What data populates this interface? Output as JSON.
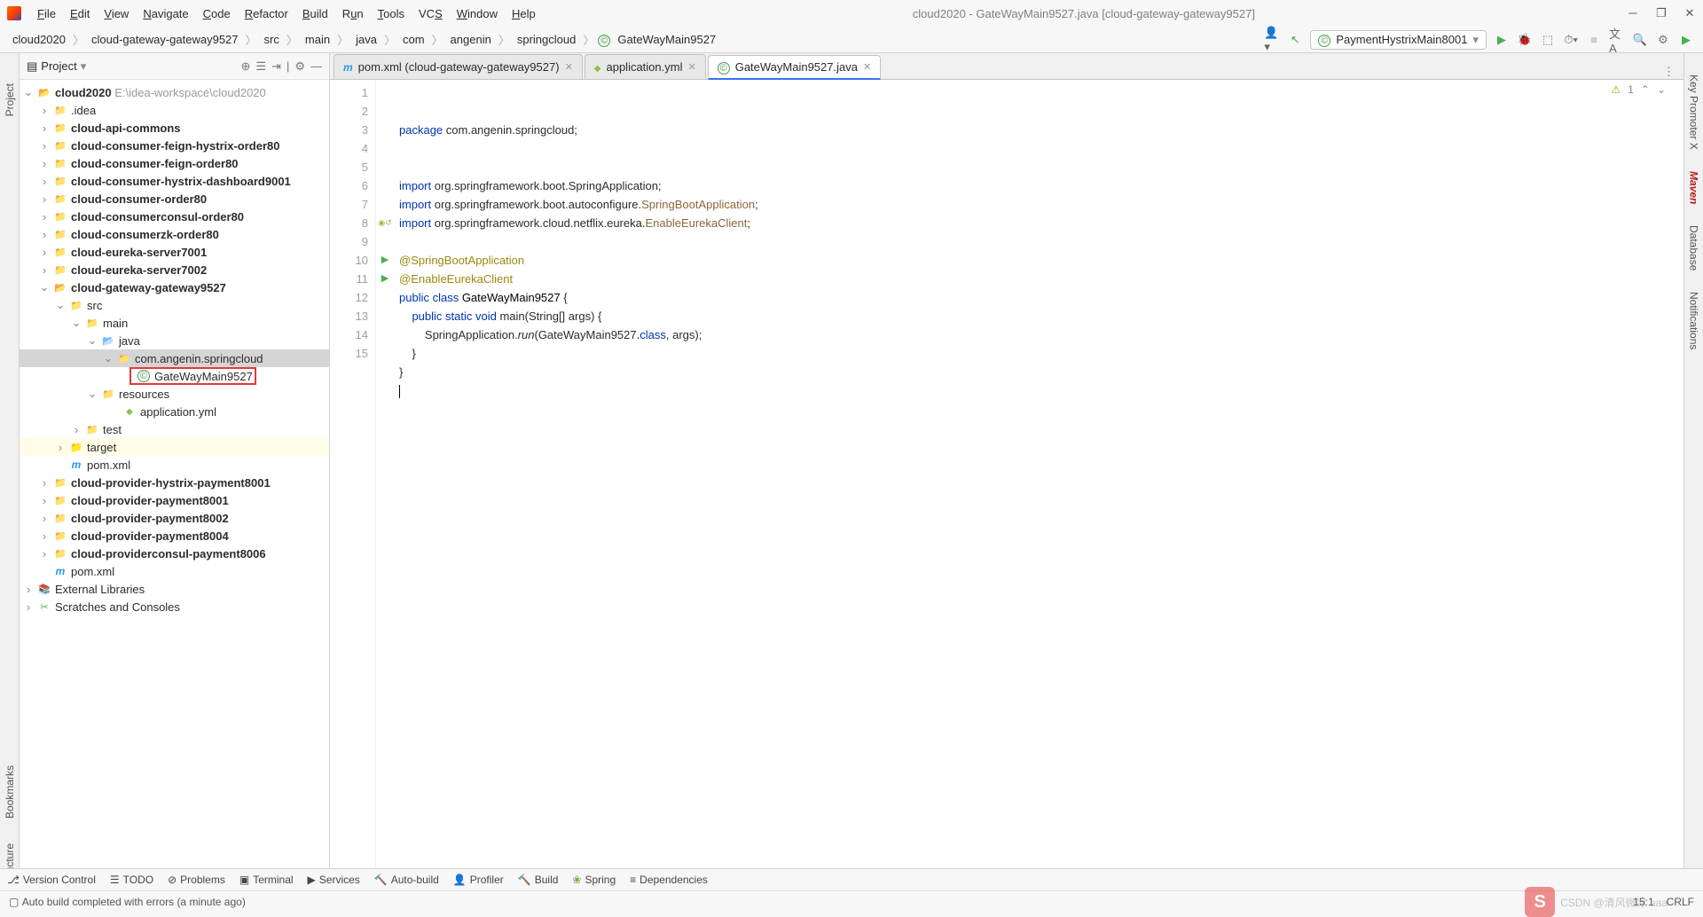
{
  "window": {
    "title": "cloud2020 - GateWayMain9527.java [cloud-gateway-gateway9527]"
  },
  "menu": [
    "File",
    "Edit",
    "View",
    "Navigate",
    "Code",
    "Refactor",
    "Build",
    "Run",
    "Tools",
    "VCS",
    "Window",
    "Help"
  ],
  "breadcrumb": [
    "cloud2020",
    "cloud-gateway-gateway9527",
    "src",
    "main",
    "java",
    "com",
    "angenin",
    "springcloud",
    "GateWayMain9527"
  ],
  "runconfig": "PaymentHystrixMain8001",
  "sidebar": {
    "title": "Project",
    "root": {
      "name": "cloud2020",
      "path": "E:\\idea-workspace\\cloud2020"
    },
    "items": [
      {
        "name": ".idea",
        "bold": false
      },
      {
        "name": "cloud-api-commons",
        "bold": true
      },
      {
        "name": "cloud-consumer-feign-hystrix-order80",
        "bold": true
      },
      {
        "name": "cloud-consumer-feign-order80",
        "bold": true
      },
      {
        "name": "cloud-consumer-hystrix-dashboard9001",
        "bold": true
      },
      {
        "name": "cloud-consumer-order80",
        "bold": true
      },
      {
        "name": "cloud-consumerconsul-order80",
        "bold": true
      },
      {
        "name": "cloud-consumerzk-order80",
        "bold": true
      },
      {
        "name": "cloud-eureka-server7001",
        "bold": true
      },
      {
        "name": "cloud-eureka-server7002",
        "bold": true
      }
    ],
    "gateway": {
      "name": "cloud-gateway-gateway9527",
      "src": "src",
      "main": "main",
      "java": "java",
      "pkg": "com.angenin.springcloud",
      "file": "GateWayMain9527",
      "resources": "resources",
      "yml": "application.yml",
      "test": "test",
      "target": "target",
      "pom": "pom.xml"
    },
    "items2": [
      {
        "name": "cloud-provider-hystrix-payment8001"
      },
      {
        "name": "cloud-provider-payment8001"
      },
      {
        "name": "cloud-provider-payment8002"
      },
      {
        "name": "cloud-provider-payment8004"
      },
      {
        "name": "cloud-providerconsul-payment8006"
      }
    ],
    "pom": "pom.xml",
    "ext": "External Libraries",
    "scratch": "Scratches and Consoles"
  },
  "leftrail": [
    "Project",
    "Bookmarks",
    "Structure"
  ],
  "rightrail": [
    "Key Promoter X",
    "Maven",
    "Database",
    "Notifications"
  ],
  "tabs": [
    {
      "label": "pom.xml (cloud-gateway-gateway9527)",
      "icon": "m"
    },
    {
      "label": "application.yml",
      "icon": "yml"
    },
    {
      "label": "GateWayMain9527.java",
      "icon": "java",
      "active": true
    }
  ],
  "code": {
    "lines": [
      "1",
      "2",
      "3",
      "4",
      "5",
      "6",
      "7",
      "8",
      "9",
      "10",
      "11",
      "12",
      "13",
      "14",
      "15"
    ],
    "l1_kw": "package",
    "l1_rest": " com.angenin.springcloud;",
    "l4_kw": "import",
    "l4_rest": " org.springframework.boot.SpringApplication;",
    "l5_kw": "import",
    "l5_rest1": " org.springframework.boot.autoconfigure.",
    "l5_cls": "SpringBootApplication",
    "l5_rest2": ";",
    "l6_kw": "import",
    "l6_rest1": " org.springframework.cloud.netflix.eureka.",
    "l6_cls": "EnableEurekaClient",
    "l6_rest2": ";",
    "l8": "@SpringBootApplication",
    "l9": "@EnableEurekaClient",
    "l10_kw1": "public ",
    "l10_kw2": "class ",
    "l10_cls": "GateWayMain9527",
    "l10_rest": " {",
    "l11_kw1": "    public ",
    "l11_kw2": "static ",
    "l11_kw3": "void ",
    "l11_fn": "main",
    "l11_rest": "(String[] args) {",
    "l12_pre": "        SpringApplication.",
    "l12_fn": "run",
    "l12_rest1": "(GateWayMain9527.",
    "l12_kw": "class",
    "l12_rest2": ", args);",
    "l13": "    }",
    "l14": "}"
  },
  "warnings": {
    "count": "1"
  },
  "bottombar": [
    "Version Control",
    "TODO",
    "Problems",
    "Terminal",
    "Services",
    "Auto-build",
    "Profiler",
    "Build",
    "Spring",
    "Dependencies"
  ],
  "status": {
    "msg": "Auto build completed with errors (a minute ago)",
    "pos": "15:1",
    "enc": "CRLF",
    "watermark": "CSDN @清风微凉 aaa"
  }
}
